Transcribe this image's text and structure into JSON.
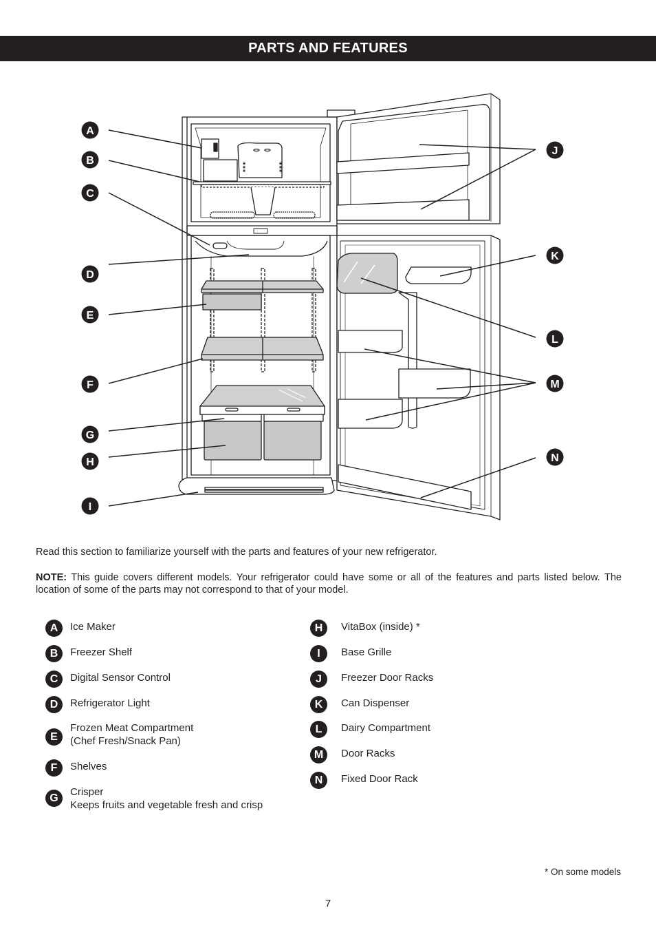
{
  "header": {
    "title": "PARTS AND FEATURES"
  },
  "diagram": {
    "callouts": [
      "A",
      "B",
      "C",
      "D",
      "E",
      "F",
      "G",
      "H",
      "I",
      "J",
      "K",
      "L",
      "M",
      "N"
    ],
    "colors": {
      "badge": "#231f20",
      "glass": "#cfcfcf",
      "line": "#231f20"
    }
  },
  "intro": "Read this section to familiarize yourself with the parts and features of your new refrigerator.",
  "note": {
    "label": "NOTE:",
    "text": " This guide covers different models. Your refrigerator could have some or all of the features and parts listed below. The location of some of the parts may not correspond to that of your model."
  },
  "legend": {
    "left": [
      {
        "letter": "A",
        "lines": [
          "Ice Maker"
        ]
      },
      {
        "letter": "B",
        "lines": [
          "Freezer Shelf"
        ]
      },
      {
        "letter": "C",
        "lines": [
          "Digital Sensor Control"
        ]
      },
      {
        "letter": "D",
        "lines": [
          "Refrigerator Light"
        ]
      },
      {
        "letter": "E",
        "lines": [
          "Frozen Meat Compartment",
          "(Chef Fresh/Snack Pan)"
        ]
      },
      {
        "letter": "F",
        "lines": [
          "Shelves"
        ]
      },
      {
        "letter": "G",
        "lines": [
          "Crisper",
          "Keeps fruits and vegetable fresh and crisp"
        ]
      }
    ],
    "right": [
      {
        "letter": "H",
        "lines": [
          "VitaBox (inside) *"
        ]
      },
      {
        "letter": "I",
        "lines": [
          "Base Grille"
        ]
      },
      {
        "letter": "J",
        "lines": [
          "Freezer Door Racks"
        ]
      },
      {
        "letter": "K",
        "lines": [
          "Can Dispenser"
        ]
      },
      {
        "letter": "L",
        "lines": [
          "Dairy Compartment"
        ]
      },
      {
        "letter": "M",
        "lines": [
          "Door Racks"
        ]
      },
      {
        "letter": "N",
        "lines": [
          "Fixed Door Rack"
        ]
      }
    ]
  },
  "footnote": "* On some models",
  "page_number": "7"
}
